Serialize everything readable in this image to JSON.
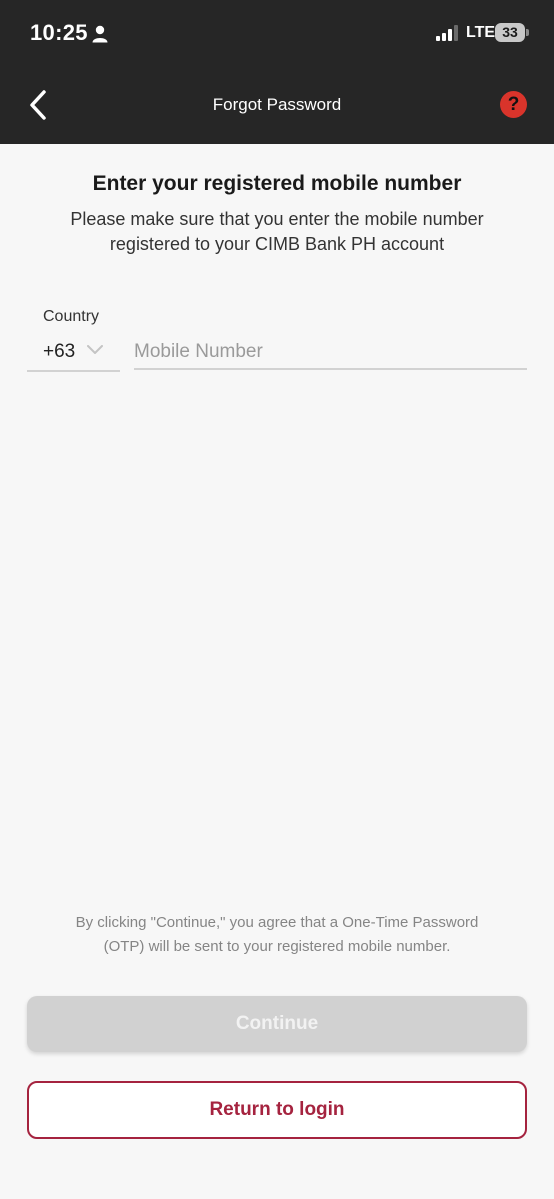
{
  "status_bar": {
    "time": "10:25",
    "network": "LTE",
    "battery": "33"
  },
  "nav": {
    "title": "Forgot Password",
    "help_icon": "?"
  },
  "content": {
    "heading": "Enter your registered mobile number",
    "subtext": "Please make sure that you enter the mobile number registered to your CIMB Bank PH account"
  },
  "form": {
    "country_label": "Country",
    "country_code": "+63",
    "mobile_placeholder": "Mobile Number",
    "mobile_value": ""
  },
  "footer": {
    "disclaimer": "By clicking \"Continue,\" you agree that a One-Time Password (OTP) will be sent to your registered mobile number.",
    "continue_label": "Continue",
    "return_label": "Return to login"
  },
  "colors": {
    "header_bg": "#262626",
    "accent": "#a5233f",
    "help_red": "#d9342b",
    "disabled_button": "#d1d1d1"
  },
  "icons": [
    "person-icon",
    "signal-icon",
    "battery-icon",
    "back-chevron-icon",
    "help-icon",
    "chevron-down-icon"
  ]
}
